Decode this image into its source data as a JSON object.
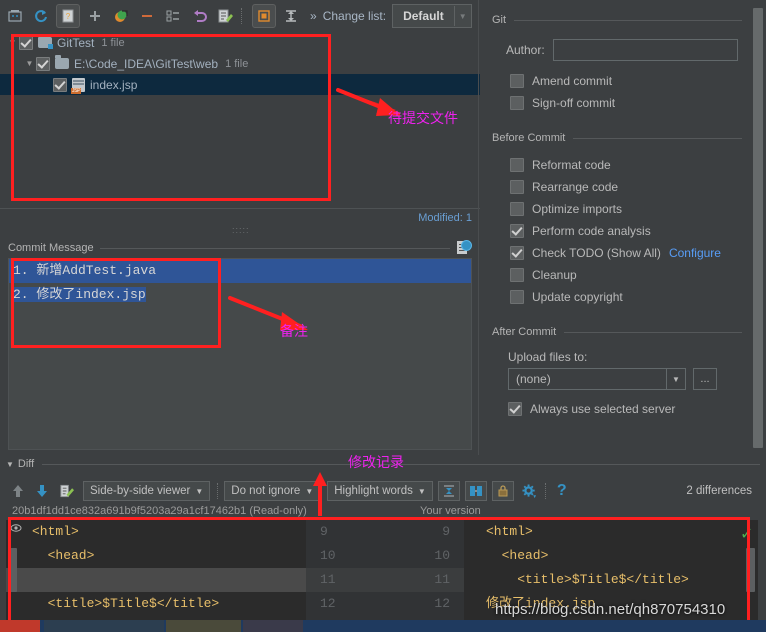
{
  "toolbar": {
    "icons": [
      "commit-icon",
      "refresh-icon",
      "show-diff-icon",
      "add-icon",
      "revert-arrow-icon",
      "minus-icon",
      "group-by-icon",
      "rollback-icon",
      "edit-source-icon",
      "preview-icon",
      "expand-collapse-icon"
    ],
    "overflow_label": "»",
    "changelist_label": "Change list:",
    "changelist_value": "Default"
  },
  "filetree": {
    "rows": [
      {
        "indent": 0,
        "expander": "▼",
        "icon": "folder-modified-icon",
        "name": "GitTest",
        "count": "1 file",
        "selected": false
      },
      {
        "indent": 1,
        "expander": "▼",
        "icon": "folder-icon",
        "name": "E:\\Code_IDEA\\GitTest\\web",
        "count": "1 file",
        "selected": false
      },
      {
        "indent": 2,
        "expander": "",
        "icon": "jsp-file-icon",
        "name": "index.jsp",
        "count": "",
        "selected": true
      }
    ],
    "modified_label": "Modified: 1"
  },
  "commit_message": {
    "header": "Commit Message",
    "header_mnemonic": "C",
    "lines": [
      "1. 新增AddTest.java",
      "2. 修改了index.jsp"
    ],
    "history_icon": "commit-message-history-icon"
  },
  "right_panel": {
    "git_group": "Git",
    "author_label": "Author:",
    "author_mnemonic": "A",
    "author_value": "",
    "git_checks": [
      {
        "label": "Amend commit",
        "checked": false,
        "mnemonic": "m"
      },
      {
        "label": "Sign-off commit",
        "checked": false,
        "mnemonic": "g"
      }
    ],
    "before_commit_group": "Before Commit",
    "before_checks": [
      {
        "label": "Reformat code",
        "checked": false,
        "mnemonic": "R"
      },
      {
        "label": "Rearrange code",
        "checked": false,
        "mnemonic": "n"
      },
      {
        "label": "Optimize imports",
        "checked": false,
        "mnemonic": "O"
      },
      {
        "label": "Perform code analysis",
        "checked": true,
        "mnemonic": "s"
      },
      {
        "label": "Check TODO (Show All)",
        "checked": true,
        "link": "Configure"
      },
      {
        "label": "Cleanup",
        "checked": false,
        "mnemonic": "l"
      },
      {
        "label": "Update copyright",
        "checked": false,
        "mnemonic": "U"
      }
    ],
    "after_commit_group": "After Commit",
    "upload_label": "Upload files to:",
    "upload_value": "(none)",
    "upload_browse": "...",
    "always_use_label": "Always use selected server",
    "always_use_checked": true
  },
  "diff": {
    "section_label": "Diff",
    "toolbar": {
      "prev_diff_icon": "arrow-up-icon",
      "next_diff_icon": "arrow-down-icon",
      "edit_icon": "edit-source-icon",
      "viewer_mode": "Side-by-side viewer",
      "ignore_mode": "Do not ignore",
      "highlight_mode": "Highlight words",
      "collapse_icon": "collapse-unchanged-icon",
      "sync_icon": "synchronize-scroll-icon",
      "lock_icon": "lock-icon",
      "settings_icon": "gear-icon",
      "help_icon": "help-icon",
      "difference_count": "2 differences"
    },
    "left_title": "20b1df1dd1ce832a691b9f5203a29a1cf17462b1 (Read-only)",
    "right_title": "Your version",
    "rows": [
      {
        "left": "<html>",
        "ln_left": "9",
        "ln_right": "9",
        "right": "<html>",
        "state": "same"
      },
      {
        "left": "  <head>",
        "ln_left": "10",
        "ln_right": "10",
        "right": "  <head>",
        "state": "same"
      },
      {
        "left": "",
        "ln_left": "11",
        "ln_right": "11",
        "right": "    <title>$Title$</title>",
        "state": "inserted"
      },
      {
        "left": "  <title>$Title$</title>",
        "ln_left": "12",
        "ln_right": "12",
        "right": "修改了index.jsp",
        "state": "same"
      }
    ]
  },
  "annotations": {
    "files_note": "待提交文件",
    "message_note": "备注",
    "diff_note": "修改记录"
  },
  "watermark": "https://blog.csdn.net/qh870754310"
}
